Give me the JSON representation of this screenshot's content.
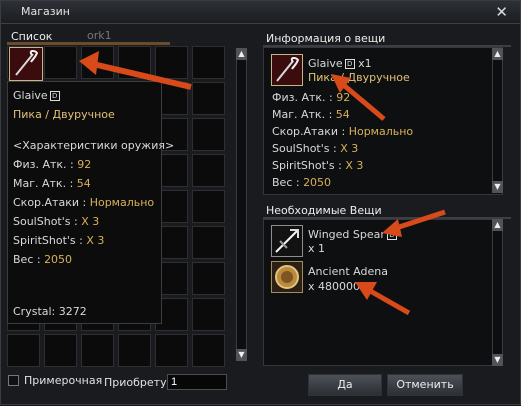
{
  "window": {
    "title": "Магазин",
    "close_label": "✕"
  },
  "left": {
    "tabs": [
      "Список",
      "ork1"
    ],
    "tooltip": {
      "name": "Glaive",
      "type": "Пика / Двуручное",
      "header": "<Характеристики оружия>",
      "stats": [
        {
          "label": "Физ. Атк. : ",
          "value": "92"
        },
        {
          "label": "Маг. Атк. : ",
          "value": "54"
        },
        {
          "label": "Скор.Атаки : ",
          "value": "Нормально"
        },
        {
          "label": "SoulShot's : ",
          "value": "X 3"
        },
        {
          "label": "SpiritShot's : ",
          "value": "X 3"
        },
        {
          "label": "Вес : ",
          "value": "2050"
        }
      ],
      "crystal": "Crystal: 3272"
    }
  },
  "right": {
    "info_title": "Информация о вещи",
    "item": {
      "name": "Glaive",
      "qty": "x1",
      "type": "Пика / Двуручное",
      "stats": [
        {
          "label": "Физ. Атк. : ",
          "value": "92"
        },
        {
          "label": "Маг. Атк. : ",
          "value": "54"
        },
        {
          "label": "Скор.Атаки : ",
          "value": "Нормально"
        },
        {
          "label": "SoulShot's : ",
          "value": "X 3"
        },
        {
          "label": "SpiritShot's : ",
          "value": "X 3"
        },
        {
          "label": "Вес : ",
          "value": "2050"
        }
      ]
    },
    "needed_title": "Необходимые Вещи",
    "needed": [
      {
        "name": "Winged Spear",
        "qty": "x 1"
      },
      {
        "name": "Ancient Adena",
        "qty": "x 480000"
      }
    ]
  },
  "bottom": {
    "checkbox_label": "Примерочная",
    "qty_label": "Приобрету",
    "qty_value": "1",
    "ok_label": "Да",
    "cancel_label": "Отменить"
  },
  "scroll_up": "▲",
  "scroll_down": "▼"
}
